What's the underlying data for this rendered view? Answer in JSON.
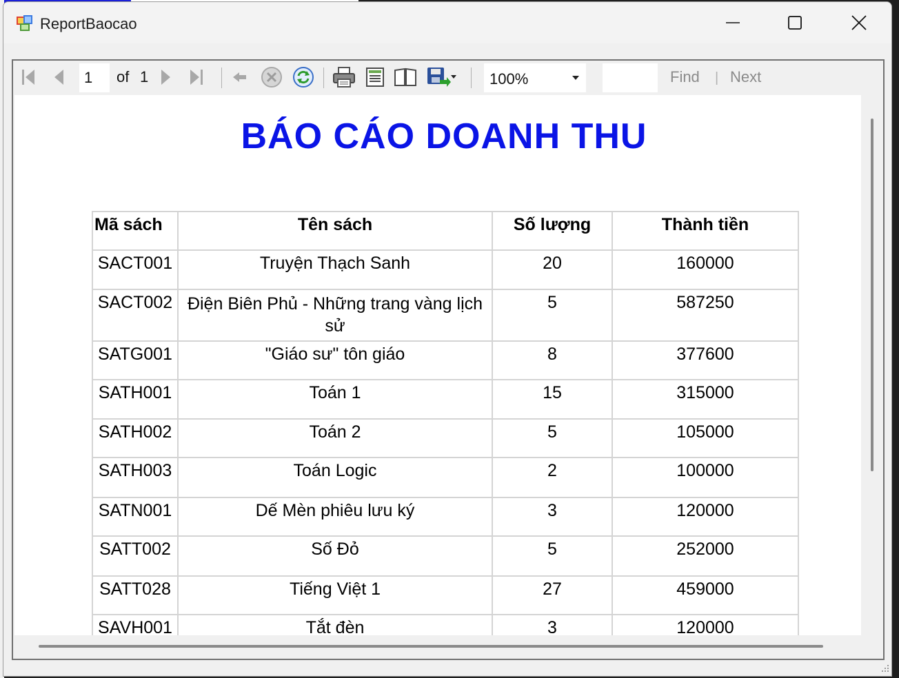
{
  "window": {
    "title": "ReportBaocao"
  },
  "toolbar": {
    "current_page": "1",
    "of_label": "of",
    "total_pages": "1",
    "zoom": "100%",
    "find_label": "Find",
    "find_separator": "|",
    "next_label": "Next"
  },
  "report": {
    "title": "BÁO CÁO DOANH THU",
    "columns": [
      "Mã sách",
      "Tên sách",
      "Số lượng",
      "Thành tiền"
    ],
    "rows": [
      [
        "SACT001",
        "Truyện Thạch Sanh",
        "20",
        "160000"
      ],
      [
        "SACT002",
        "Điện Biên Phủ - Những trang vàng lịch sử",
        "5",
        "587250"
      ],
      [
        "SATG001",
        "\"Giáo sư\" tôn giáo",
        "8",
        "377600"
      ],
      [
        "SATH001",
        "Toán 1",
        "15",
        "315000"
      ],
      [
        "SATH002",
        "Toán 2",
        "5",
        "105000"
      ],
      [
        "SATH003",
        "Toán Logic",
        "2",
        "100000"
      ],
      [
        "SATN001",
        "Dế Mèn phiêu lưu ký",
        "3",
        "120000"
      ],
      [
        "SATT002",
        "Số Đỏ",
        "5",
        "252000"
      ],
      [
        "SATT028",
        "Tiếng Việt 1",
        "27",
        "459000"
      ],
      [
        "SAVH001",
        "Tắt đèn",
        "3",
        "120000"
      ]
    ]
  },
  "icons": {
    "first_page": "first-page-icon",
    "prev_page": "previous-page-icon",
    "next_page": "next-page-icon",
    "last_page": "last-page-icon",
    "back": "back-icon",
    "stop": "stop-icon",
    "refresh": "refresh-icon",
    "print": "print-icon",
    "print_layout": "print-layout-icon",
    "page_setup": "page-setup-icon",
    "export": "export-icon"
  },
  "colors": {
    "title": "#0a14e6",
    "grid_border": "#d4d4d4"
  }
}
